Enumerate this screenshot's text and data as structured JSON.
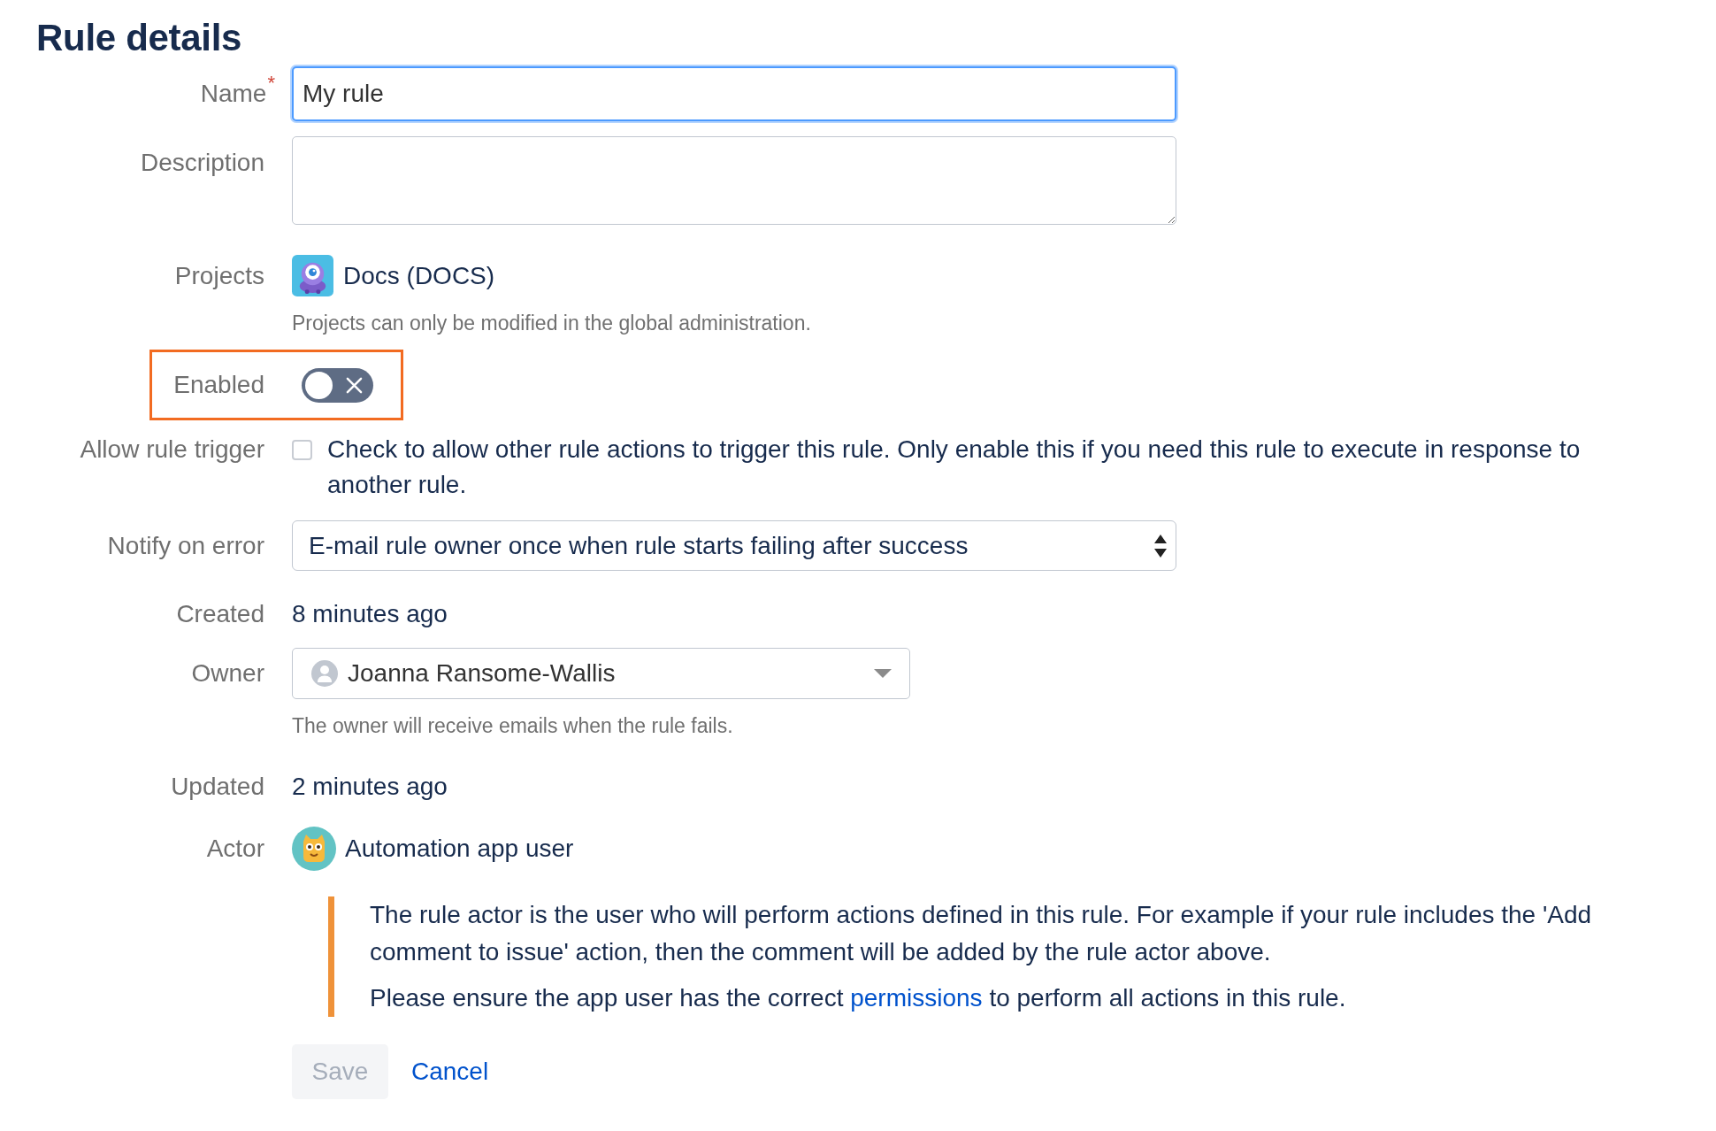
{
  "title": "Rule details",
  "fields": [
    {
      "kind": "text",
      "label": "Name",
      "required_mark": "*",
      "value": "My rule",
      "focused": true
    },
    {
      "kind": "textarea",
      "label": "Description"
    },
    {
      "kind": "projects",
      "label": "Projects",
      "projects": [
        {
          "name": "Docs (DOCS)"
        }
      ],
      "hint": "Projects can only be modified in the global administration."
    },
    {
      "kind": "toggle",
      "label": "Enabled",
      "on": false,
      "highlighted": true
    },
    {
      "kind": "checkbox",
      "label": "Allow rule trigger",
      "checked": false,
      "text": "Check to allow other rule actions to trigger this rule. Only enable this if you need this rule to execute in response to another rule."
    },
    {
      "kind": "select",
      "label": "Notify on error",
      "value": "E-mail rule owner once when rule starts failing after success"
    },
    {
      "kind": "static",
      "label": "Created",
      "value": "8 minutes ago"
    },
    {
      "kind": "user_select",
      "label": "Owner",
      "value": "Joanna Ransome-Wallis",
      "hint": "The owner will receive emails when the rule fails."
    },
    {
      "kind": "static",
      "label": "Updated",
      "value": "2 minutes ago"
    },
    {
      "kind": "actor",
      "label": "Actor",
      "value": "Automation app user",
      "notice": {
        "paragraphs": [
          {
            "segments": [
              {
                "kind": "text",
                "text": "The rule actor is the user who will perform actions defined in this rule. For example if your rule includes the 'Add comment to issue' action, then the comment will be added by the rule actor above."
              }
            ]
          },
          {
            "segments": [
              {
                "kind": "text",
                "text": "Please ensure the app user has the correct "
              },
              {
                "kind": "link",
                "text": "permissions"
              },
              {
                "kind": "text",
                "text": " to perform all actions in this rule."
              }
            ]
          }
        ]
      }
    }
  ],
  "buttons": [
    {
      "kind": "button",
      "label": "Save",
      "disabled": true
    },
    {
      "kind": "link",
      "label": "Cancel",
      "disabled": false
    }
  ]
}
